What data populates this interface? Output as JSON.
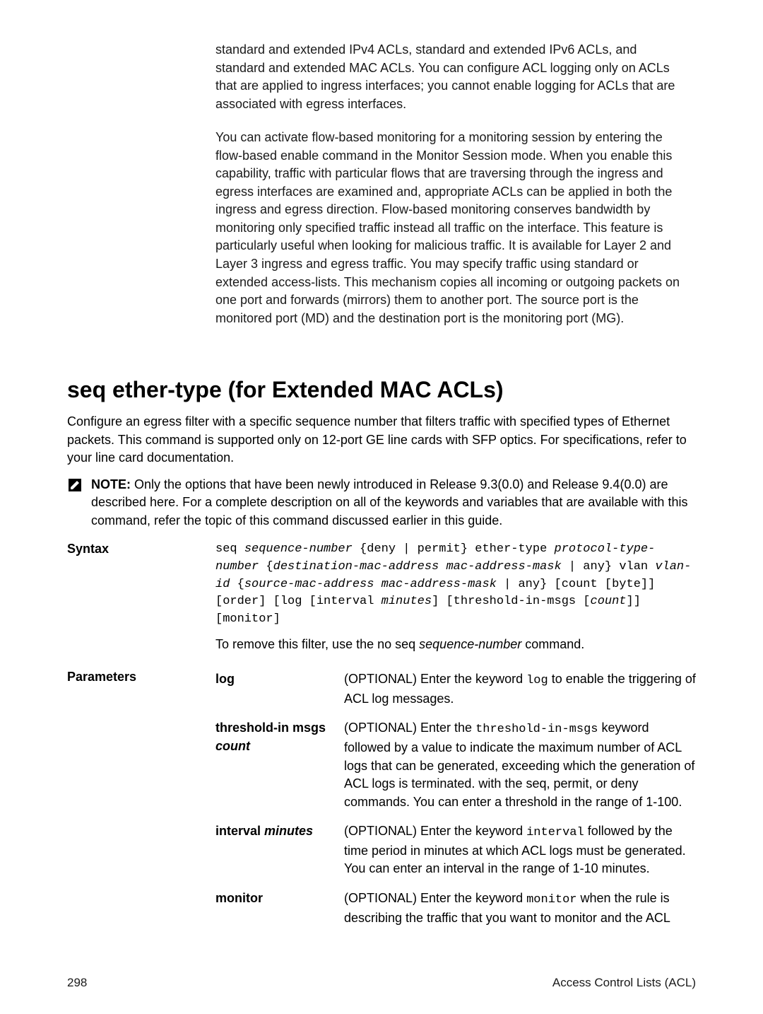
{
  "intro": {
    "p1": "standard and extended IPv4 ACLs, standard and extended IPv6 ACLs, and standard and extended MAC ACLs. You can configure ACL logging only on ACLs that are applied to ingress interfaces; you cannot enable logging for ACLs that are associated with egress interfaces.",
    "p2": "You can activate flow-based monitoring for a monitoring session by entering the flow-based enable command in the Monitor Session mode. When you enable this capability, traffic with particular flows that are traversing through the ingress and egress interfaces are examined and, appropriate ACLs can be applied in both the ingress and egress direction. Flow-based monitoring conserves bandwidth by monitoring only specified traffic instead all traffic on the interface. This feature is particularly useful when looking for malicious traffic. It is available for Layer 2 and Layer 3 ingress and egress traffic. You may specify traffic using standard or extended access-lists. This mechanism copies all incoming or outgoing packets on one port and forwards (mirrors) them to another port. The source port is the monitored port (MD) and the destination port is the monitoring port (MG)."
  },
  "section": {
    "title": "seq ether-type (for Extended MAC ACLs)",
    "lead": "Configure an egress filter with a specific sequence number that filters traffic with specified types of Ethernet packets. This command is supported only on 12-port GE line cards with SFP optics. For specifications, refer to your line card documentation.",
    "note_label": "NOTE:",
    "note_text": " Only the options that have been newly introduced in Release 9.3(0.0) and Release 9.4(0.0) are described here. For a complete description on all of the keywords and variables that are available with this command, refer the topic of this command discussed earlier in this guide."
  },
  "syntax": {
    "label": "Syntax",
    "seg1a": "seq ",
    "seg1b": "sequence-number",
    "seg1c": " {deny | permit} ether-type ",
    "seg1d": "protocol-type-number",
    "seg2a": " {",
    "seg2b": "destination-mac-address mac-address-mask",
    "seg2c": " | any} vlan ",
    "seg3a": "vlan-id",
    "seg3b": " {",
    "seg3c": "source-mac-address mac-address-mask",
    "seg3d": " | any} [count [byte]] [order] [log [interval ",
    "seg3e": "minutes",
    "seg3f": "] [threshold-in-msgs [",
    "seg3g": "count",
    "seg3h": "]] [monitor]",
    "remove_pre": "To remove this filter, use the no seq ",
    "remove_it": "sequence-number",
    "remove_post": " command."
  },
  "params": {
    "label": "Parameters",
    "rows": [
      {
        "name_plain": "log",
        "name_ital": "",
        "desc_pre": "(OPTIONAL) Enter the keyword ",
        "desc_mono": "log",
        "desc_post": " to enable the triggering of ACL log messages."
      },
      {
        "name_plain": "threshold-in msgs ",
        "name_ital": "count",
        "desc_pre": "(OPTIONAL) Enter the ",
        "desc_mono": "threshold-in-msgs",
        "desc_post": " keyword followed by a value to indicate the maximum number of ACL logs that can be generated, exceeding which the generation of ACL logs is terminated. with the seq, permit, or deny commands. You can enter a threshold in the range of 1-100."
      },
      {
        "name_plain": "interval ",
        "name_ital": "minutes",
        "desc_pre": "(OPTIONAL) Enter the keyword ",
        "desc_mono": "interval",
        "desc_post": " followed by the time period in minutes at which ACL logs must be generated. You can enter an interval in the range of 1-10 minutes."
      },
      {
        "name_plain": "monitor",
        "name_ital": "",
        "desc_pre": "(OPTIONAL) Enter the keyword ",
        "desc_mono": "monitor",
        "desc_post": " when the rule is describing the traffic that you want to monitor and the ACL"
      }
    ]
  },
  "footer": {
    "page": "298",
    "right": "Access Control Lists (ACL)"
  }
}
